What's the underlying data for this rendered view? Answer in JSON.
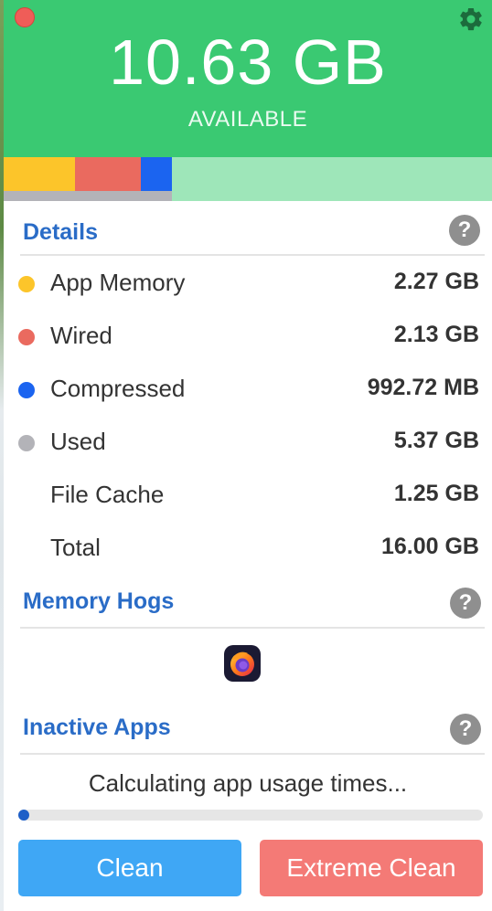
{
  "header": {
    "available_value": "10.63 GB",
    "available_label": "AVAILABLE",
    "background_color": "#3ac972"
  },
  "icons": {
    "close": "close-icon",
    "settings": "gear-icon",
    "help": "question-mark-icon",
    "app": "firefox-icon"
  },
  "memory_bar": {
    "segments": [
      {
        "name": "App Memory",
        "color": "#fcc52a",
        "value_gb": 2.27
      },
      {
        "name": "Wired",
        "color": "#ea6a5f",
        "value_gb": 2.13
      },
      {
        "name": "Compressed",
        "color": "#1b64f0",
        "value_gb": 0.97
      },
      {
        "name": "Available",
        "color": "#9ee6b9",
        "value_gb": 10.63
      }
    ],
    "used_color": "#b3b3b8"
  },
  "details": {
    "title": "Details",
    "help": "?",
    "rows": [
      {
        "label": "App Memory",
        "value": "2.27 GB",
        "dot_color": "#fcc52a"
      },
      {
        "label": "Wired",
        "value": "2.13 GB",
        "dot_color": "#ea6a5f"
      },
      {
        "label": "Compressed",
        "value": "992.72 MB",
        "dot_color": "#1b64f0"
      },
      {
        "label": "Used",
        "value": "5.37 GB",
        "dot_color": "#b3b3b8"
      },
      {
        "label": "File Cache",
        "value": "1.25 GB"
      },
      {
        "label": "Total",
        "value": "16.00 GB"
      }
    ]
  },
  "memory_hogs": {
    "title": "Memory Hogs",
    "help": "?"
  },
  "inactive_apps": {
    "title": "Inactive Apps",
    "help": "?",
    "status": "Calculating app usage times...",
    "progress_percent": 2
  },
  "buttons": {
    "clean": {
      "label": "Clean",
      "color": "#3fa7f5"
    },
    "extreme": {
      "label": "Extreme Clean",
      "color": "#f47a76"
    }
  }
}
